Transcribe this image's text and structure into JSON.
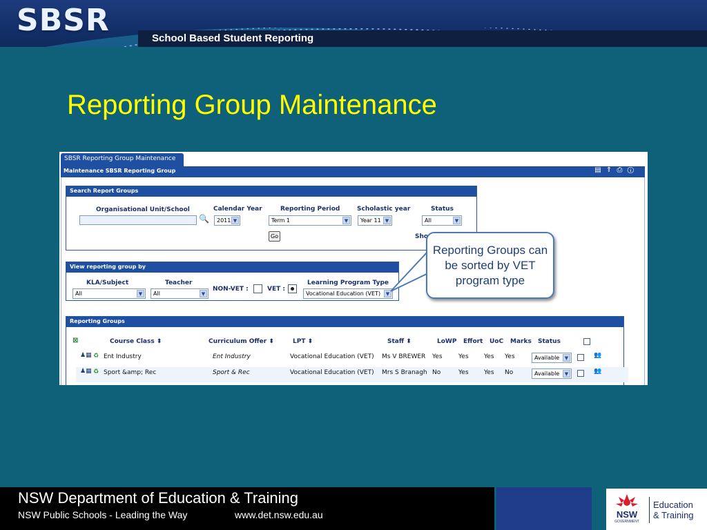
{
  "header": {
    "logo": "SBSR",
    "subtitle": "School Based Student Reporting"
  },
  "slide": {
    "title": "Reporting Group Maintenance"
  },
  "app": {
    "tab": "SBSR Reporting Group Maintenance",
    "bar_title": "Maintenance SBSR Reporting Group",
    "toolbar_icons": "▤ ⇑ ⎙ ⓘ",
    "search": {
      "heading": "Search Report Groups",
      "org_label": "Organisational Unit/School",
      "org_value": "",
      "year_label": "Calendar Year",
      "year_value": "2011",
      "period_label": "Reporting Period",
      "period_value": "Term 1",
      "scholastic_label": "Scholastic year",
      "scholastic_value": "Year 11",
      "status_label": "Status",
      "status_value": "All",
      "go_label": "Go",
      "show_label": "Sho"
    },
    "view": {
      "heading": "View reporting group by",
      "kla_label": "KLA/Subject",
      "kla_value": "All",
      "teacher_label": "Teacher",
      "teacher_value": "All",
      "nonvet_label": "NON-VET :",
      "vet_label": "VET :",
      "lpt_label": "Learning Program Type",
      "lpt_value": "Vocational Education (VET)"
    },
    "groups": {
      "heading": "Reporting Groups",
      "columns": {
        "course": "Course Class  ⬍",
        "offer": "Curriculum Offer  ⬍",
        "lpt": "LPT  ⬍",
        "staff": "Staff  ⬍",
        "lowp": "LoWP",
        "effort": "Effort",
        "uoc": "UoC",
        "marks": "Marks",
        "status": "Status"
      },
      "rows": [
        {
          "course": "Ent Industry",
          "offer": "Ent Industry",
          "lpt": "Vocational Education (VET)",
          "staff": "Ms V BREWER",
          "lowp": "Yes",
          "effort": "Yes",
          "uoc": "Yes",
          "marks": "Yes",
          "status": "Available"
        },
        {
          "course": "Sport &amp; Rec",
          "offer": "Sport & Rec",
          "lpt": "Vocational Education (VET)",
          "staff": "Mrs S Branagh",
          "lowp": "No",
          "effort": "Yes",
          "uoc": "Yes",
          "marks": "No",
          "status": "Available"
        }
      ]
    }
  },
  "callout": {
    "text": "Reporting Groups can be sorted by VET program type"
  },
  "footer": {
    "org": "NSW Department of Education & Training",
    "tagline": "NSW Public Schools - Leading the Way",
    "url": "www.det.nsw.edu.au",
    "logo_abbrev": "NSW",
    "logo_gov": "GOVERNMENT",
    "logo_line1": "Education",
    "logo_line2": "& Training"
  },
  "colors": {
    "background": "#0f6079",
    "title": "#ffff00",
    "app_accent": "#1f4fa1",
    "callout_border": "#4a7ab8"
  }
}
